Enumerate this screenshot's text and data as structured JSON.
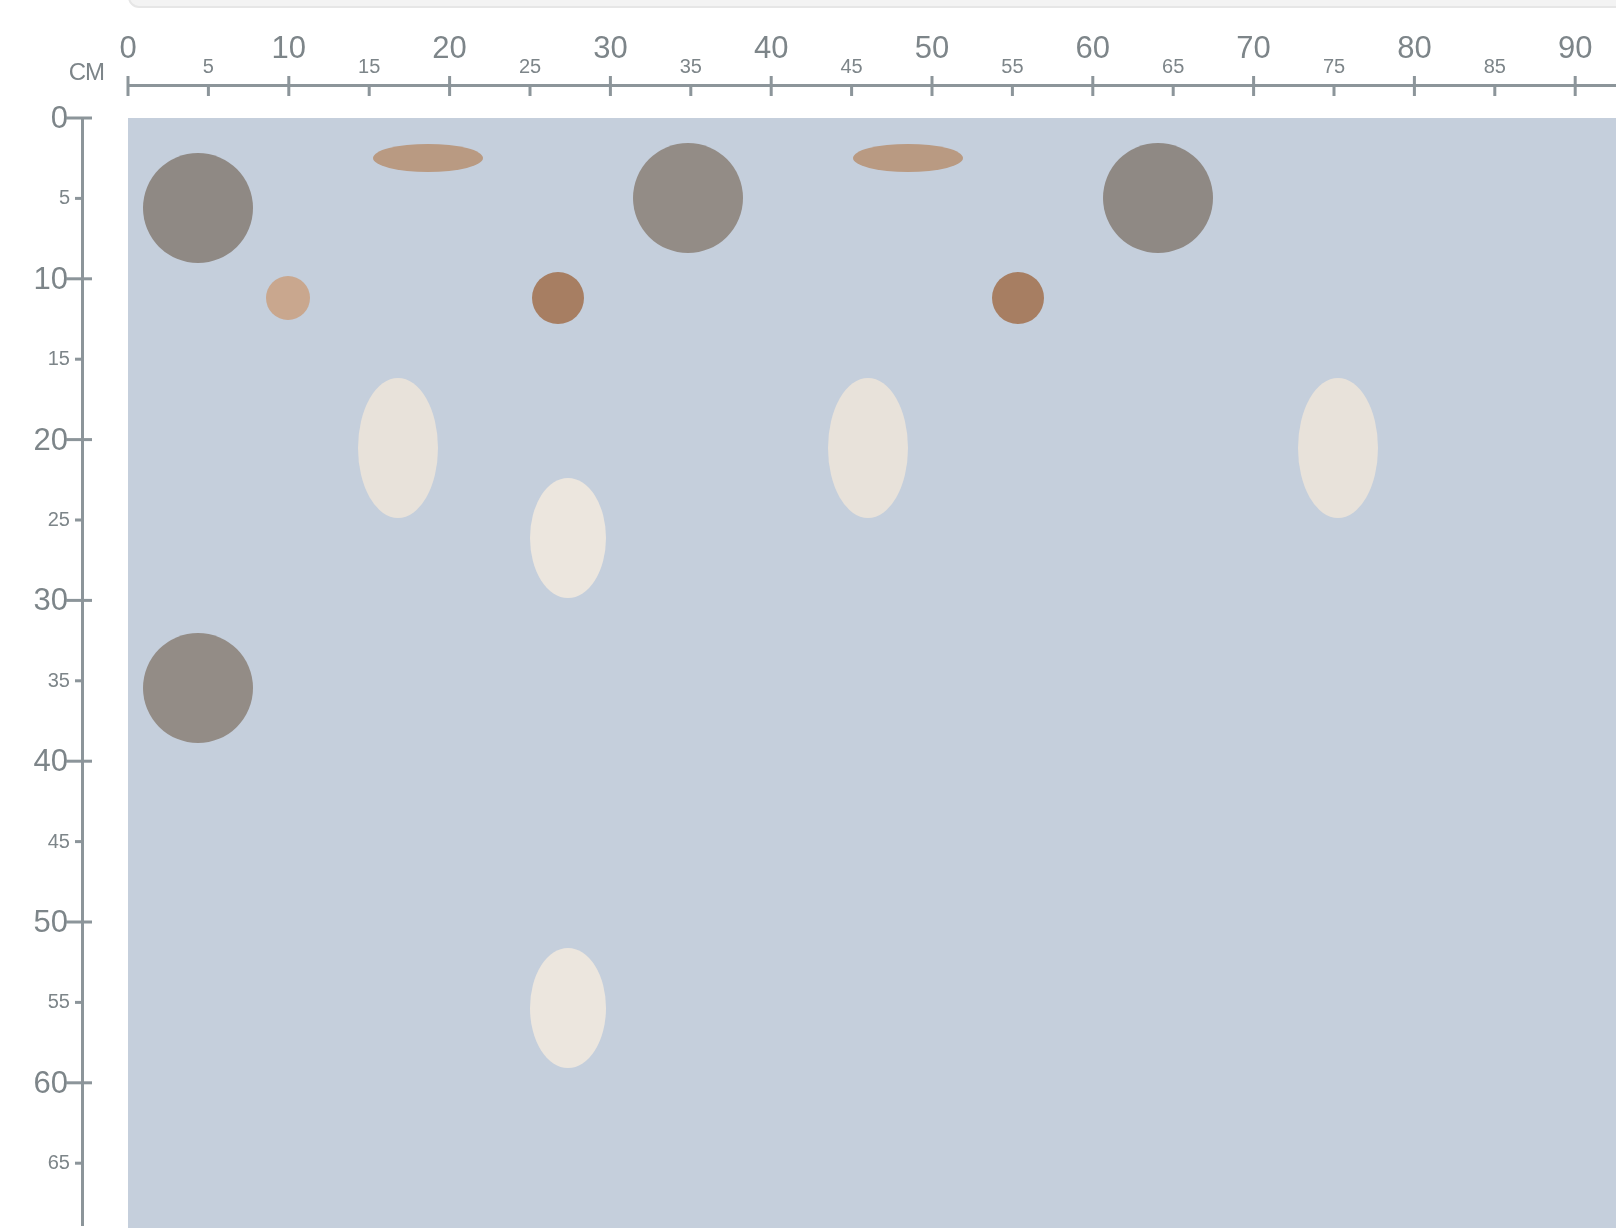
{
  "unit": "CM",
  "top_ruler": {
    "labels": [
      "0",
      "5",
      "10",
      "15",
      "20",
      "25",
      "30",
      "35",
      "40",
      "45",
      "50",
      "55",
      "60",
      "65",
      "70",
      "75",
      "80",
      "85",
      "90"
    ]
  },
  "left_ruler": {
    "labels": [
      "0",
      "5",
      "10",
      "15",
      "20",
      "25",
      "30",
      "35",
      "40",
      "45",
      "50",
      "55",
      "60",
      "65"
    ]
  }
}
